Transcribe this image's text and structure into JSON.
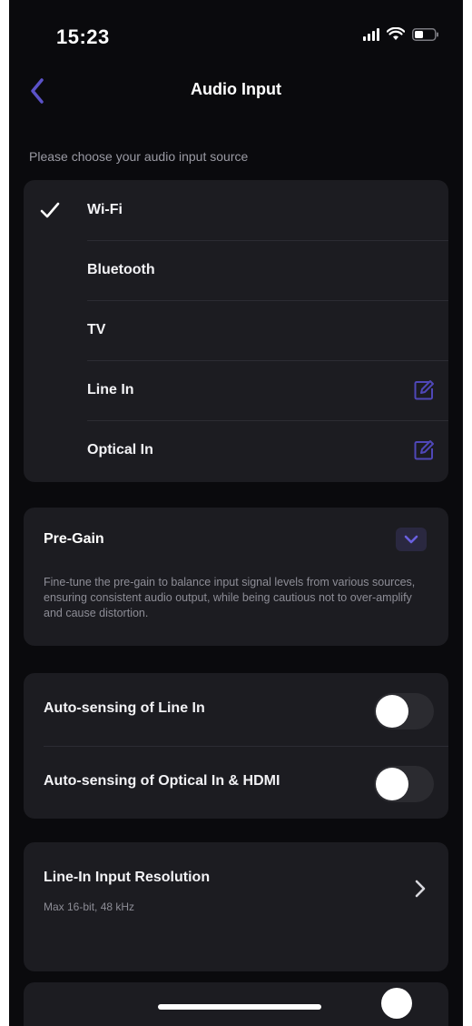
{
  "status": {
    "time": "15:23"
  },
  "header": {
    "title": "Audio Input"
  },
  "prompt": "Please choose your audio input source",
  "sources": [
    {
      "label": "Wi-Fi",
      "selected": true,
      "editable": false
    },
    {
      "label": "Bluetooth",
      "selected": false,
      "editable": false
    },
    {
      "label": "TV",
      "selected": false,
      "editable": false
    },
    {
      "label": "Line In",
      "selected": false,
      "editable": true
    },
    {
      "label": "Optical In",
      "selected": false,
      "editable": true
    }
  ],
  "pregain": {
    "title": "Pre-Gain",
    "description": "Fine-tune the pre-gain to balance input signal levels from various sources, ensuring consistent audio output, while being cautious not to over-amplify and cause distortion."
  },
  "auto_sensing": [
    {
      "label": "Auto-sensing of Line In",
      "on": false
    },
    {
      "label": "Auto-sensing of Optical In & HDMI",
      "on": false
    }
  ],
  "resolution": {
    "title": "Line-In Input Resolution",
    "subtitle": "Max 16-bit, 48 kHz"
  },
  "colors": {
    "background": "#0a0a0d",
    "card": "#1c1c21",
    "accent": "#5b52c8",
    "secondary_text": "#8d8d96"
  },
  "icons": {
    "back": "chevron-left-icon",
    "check": "checkmark-icon",
    "edit": "edit-square-icon",
    "expand": "chevron-down-icon",
    "forward": "chevron-right-icon"
  }
}
